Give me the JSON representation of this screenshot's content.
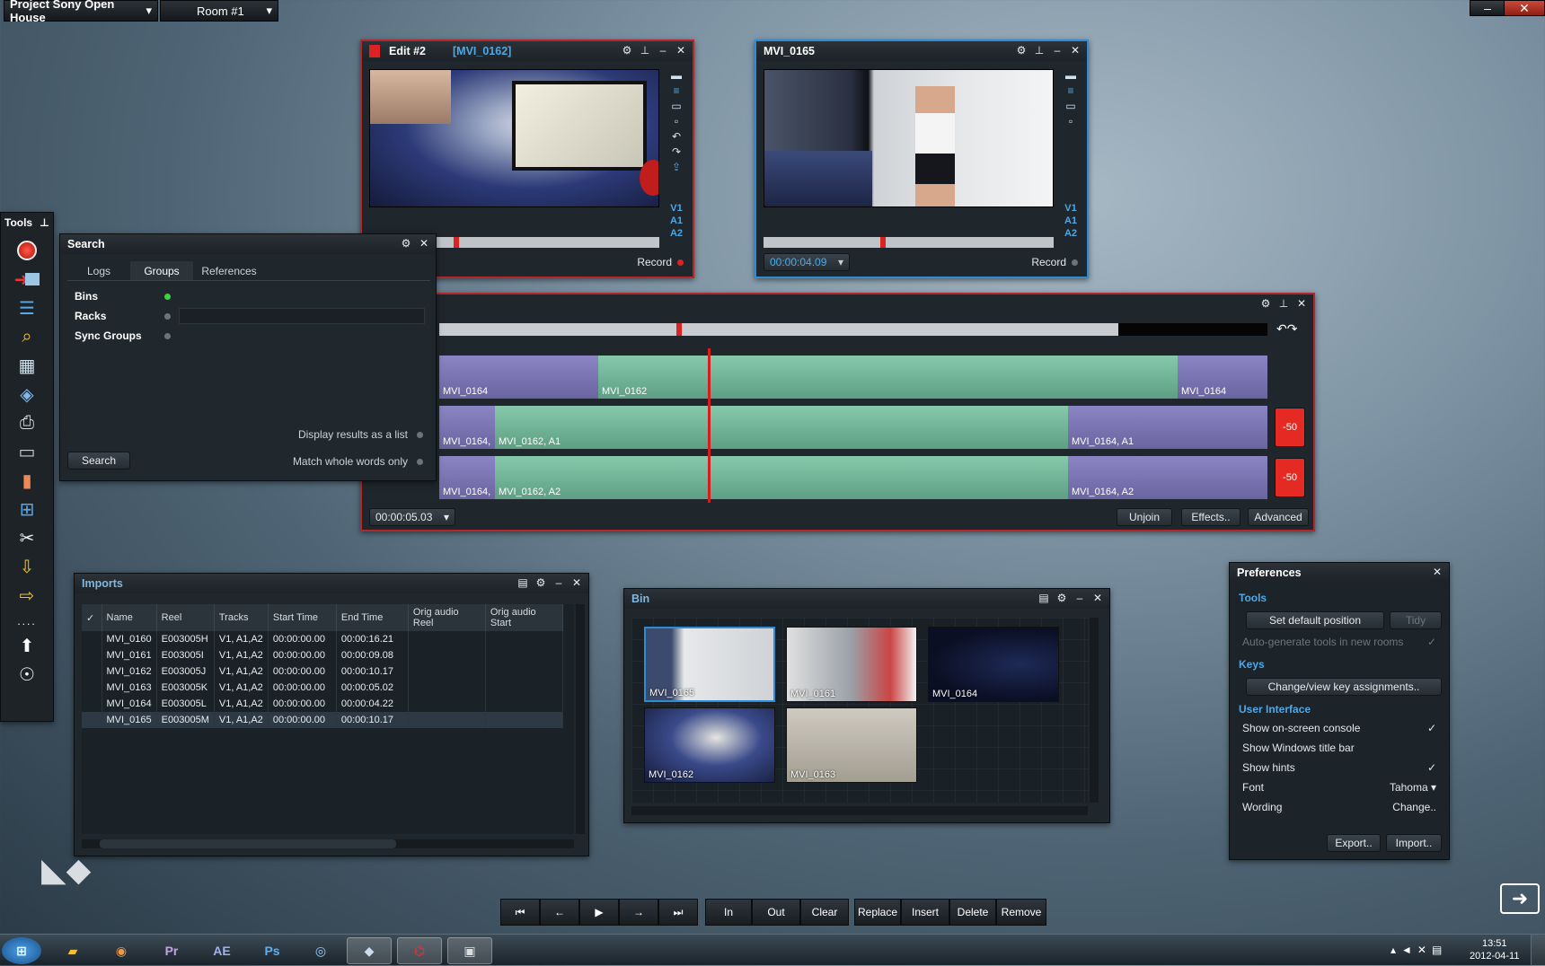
{
  "topbar": {
    "project": "Project Sony Open House",
    "room": "Room #1",
    "win_min": "–",
    "win_close": "✕"
  },
  "tools": {
    "title": "Tools"
  },
  "search": {
    "title": "Search",
    "tabs": [
      "Logs",
      "Groups",
      "References"
    ],
    "rows": [
      "Bins",
      "Racks",
      "Sync Groups"
    ],
    "display_list": "Display results as a list",
    "match_words": "Match whole words only",
    "search_btn": "Search"
  },
  "edit": {
    "title": "Edit #2",
    "clip": "[MVI_0162]",
    "record": "Record",
    "tracks": [
      "V1",
      "A1",
      "A2"
    ]
  },
  "viewer": {
    "title": "MVI_0165",
    "timecode": "00:00:04.09",
    "record": "Record",
    "tracks": [
      "V1",
      "A1",
      "A2"
    ]
  },
  "timeline": {
    "timecode": "00:00:05.03",
    "unjoin": "Unjoin",
    "effects": "Effects..",
    "advanced": "Advanced",
    "v_clips": [
      "MVI_0164",
      "MVI_0162",
      "MVI_0164"
    ],
    "a1_clips": [
      "MVI_0164,",
      "MVI_0162, A1",
      "MVI_0164, A1"
    ],
    "a2_clips": [
      "MVI_0164,",
      "MVI_0162, A2",
      "MVI_0164, A2"
    ],
    "level": "-50"
  },
  "imports": {
    "title": "Imports",
    "columns": [
      "✓",
      "Name",
      "Reel",
      "Tracks",
      "Start Time",
      "End Time",
      "Orig audio Reel",
      "Orig audio Start"
    ],
    "rows": [
      [
        "",
        "MVI_0160",
        "E003005H",
        "V1, A1,A2",
        "00:00:00.00",
        "00:00:16.21",
        "",
        ""
      ],
      [
        "",
        "MVI_0161",
        "E003005I",
        "V1, A1,A2",
        "00:00:00.00",
        "00:00:09.08",
        "",
        ""
      ],
      [
        "",
        "MVI_0162",
        "E003005J",
        "V1, A1,A2",
        "00:00:00.00",
        "00:00:10.17",
        "",
        ""
      ],
      [
        "",
        "MVI_0163",
        "E003005K",
        "V1, A1,A2",
        "00:00:00.00",
        "00:00:05.02",
        "",
        ""
      ],
      [
        "",
        "MVI_0164",
        "E003005L",
        "V1, A1,A2",
        "00:00:00.00",
        "00:00:04.22",
        "",
        ""
      ],
      [
        "",
        "MVI_0165",
        "E003005M",
        "V1, A1,A2",
        "00:00:00.00",
        "00:00:10.17",
        "",
        ""
      ]
    ]
  },
  "bin": {
    "title": "Bin",
    "items": [
      "MVI_0165",
      "MVI_0161",
      "MVI_0164",
      "MVI_0162",
      "MVI_0163"
    ]
  },
  "prefs": {
    "title": "Preferences",
    "tools_section": "Tools",
    "set_default": "Set default position",
    "tidy": "Tidy",
    "auto_gen": "Auto-generate tools in new rooms",
    "keys_section": "Keys",
    "change_keys": "Change/view key assignments..",
    "ui_section": "User Interface",
    "console": "Show on-screen console",
    "titlebar": "Show Windows title bar",
    "hints": "Show hints",
    "font_label": "Font",
    "font_value": "Tahoma",
    "wording_label": "Wording",
    "wording_value": "Change..",
    "export": "Export..",
    "import": "Import..",
    "check": "✓"
  },
  "transport": {
    "in": "In",
    "out": "Out",
    "clear": "Clear",
    "replace": "Replace",
    "insert": "Insert",
    "delete": "Delete",
    "remove": "Remove"
  },
  "taskbar": {
    "time": "13:51",
    "date": "2012-04-11",
    "apps": [
      "Pr",
      "AE",
      "Ps"
    ]
  },
  "colors": {
    "red": "#b4262a",
    "blue": "#2e8cd6",
    "accent": "#4fa8e6"
  }
}
